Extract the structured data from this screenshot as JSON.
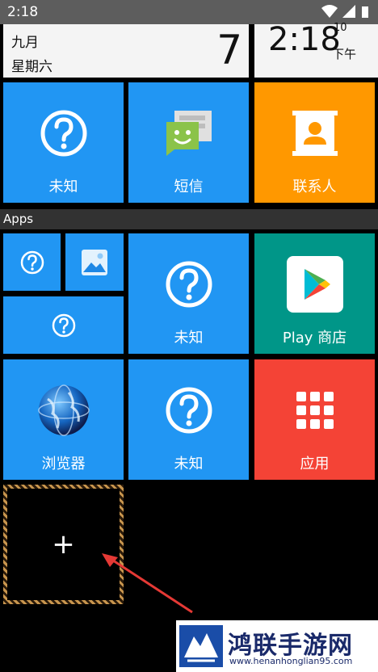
{
  "status_bar": {
    "time": "2:18"
  },
  "date_widget": {
    "month": "九月",
    "weekday": "星期六",
    "day": "7"
  },
  "clock_widget": {
    "time": "2:18",
    "seconds": "10",
    "ampm": "下午"
  },
  "tiles_top": [
    {
      "label": "未知",
      "icon": "question-icon",
      "color": "#2196f3"
    },
    {
      "label": "短信",
      "icon": "sms-icon",
      "color": "#2196f3"
    },
    {
      "label": "联系人",
      "icon": "contacts-icon",
      "color": "#ff9800"
    }
  ],
  "apps_header": {
    "label": "Apps"
  },
  "apps_tiles": [
    {
      "label": "",
      "icon": "question-icon",
      "color": "#2196f3"
    },
    {
      "label": "",
      "icon": "gallery-icon",
      "color": "#2196f3"
    },
    {
      "label": "",
      "icon": "question-icon",
      "color": "#2196f3"
    },
    {
      "label": "未知",
      "icon": "question-icon",
      "color": "#2196f3"
    },
    {
      "label": "Play 商店",
      "icon": "play-store-icon",
      "color": "#009688"
    },
    {
      "label": "浏览器",
      "icon": "globe-icon",
      "color": "#2196f3"
    },
    {
      "label": "未知",
      "icon": "question-icon",
      "color": "#2196f3"
    },
    {
      "label": "应用",
      "icon": "apps-grid-icon",
      "color": "#f44336"
    }
  ],
  "add_tile": {
    "label": "+"
  },
  "watermark": {
    "title": "鸿联手游网",
    "url": "www.henanhonglian95.com"
  }
}
